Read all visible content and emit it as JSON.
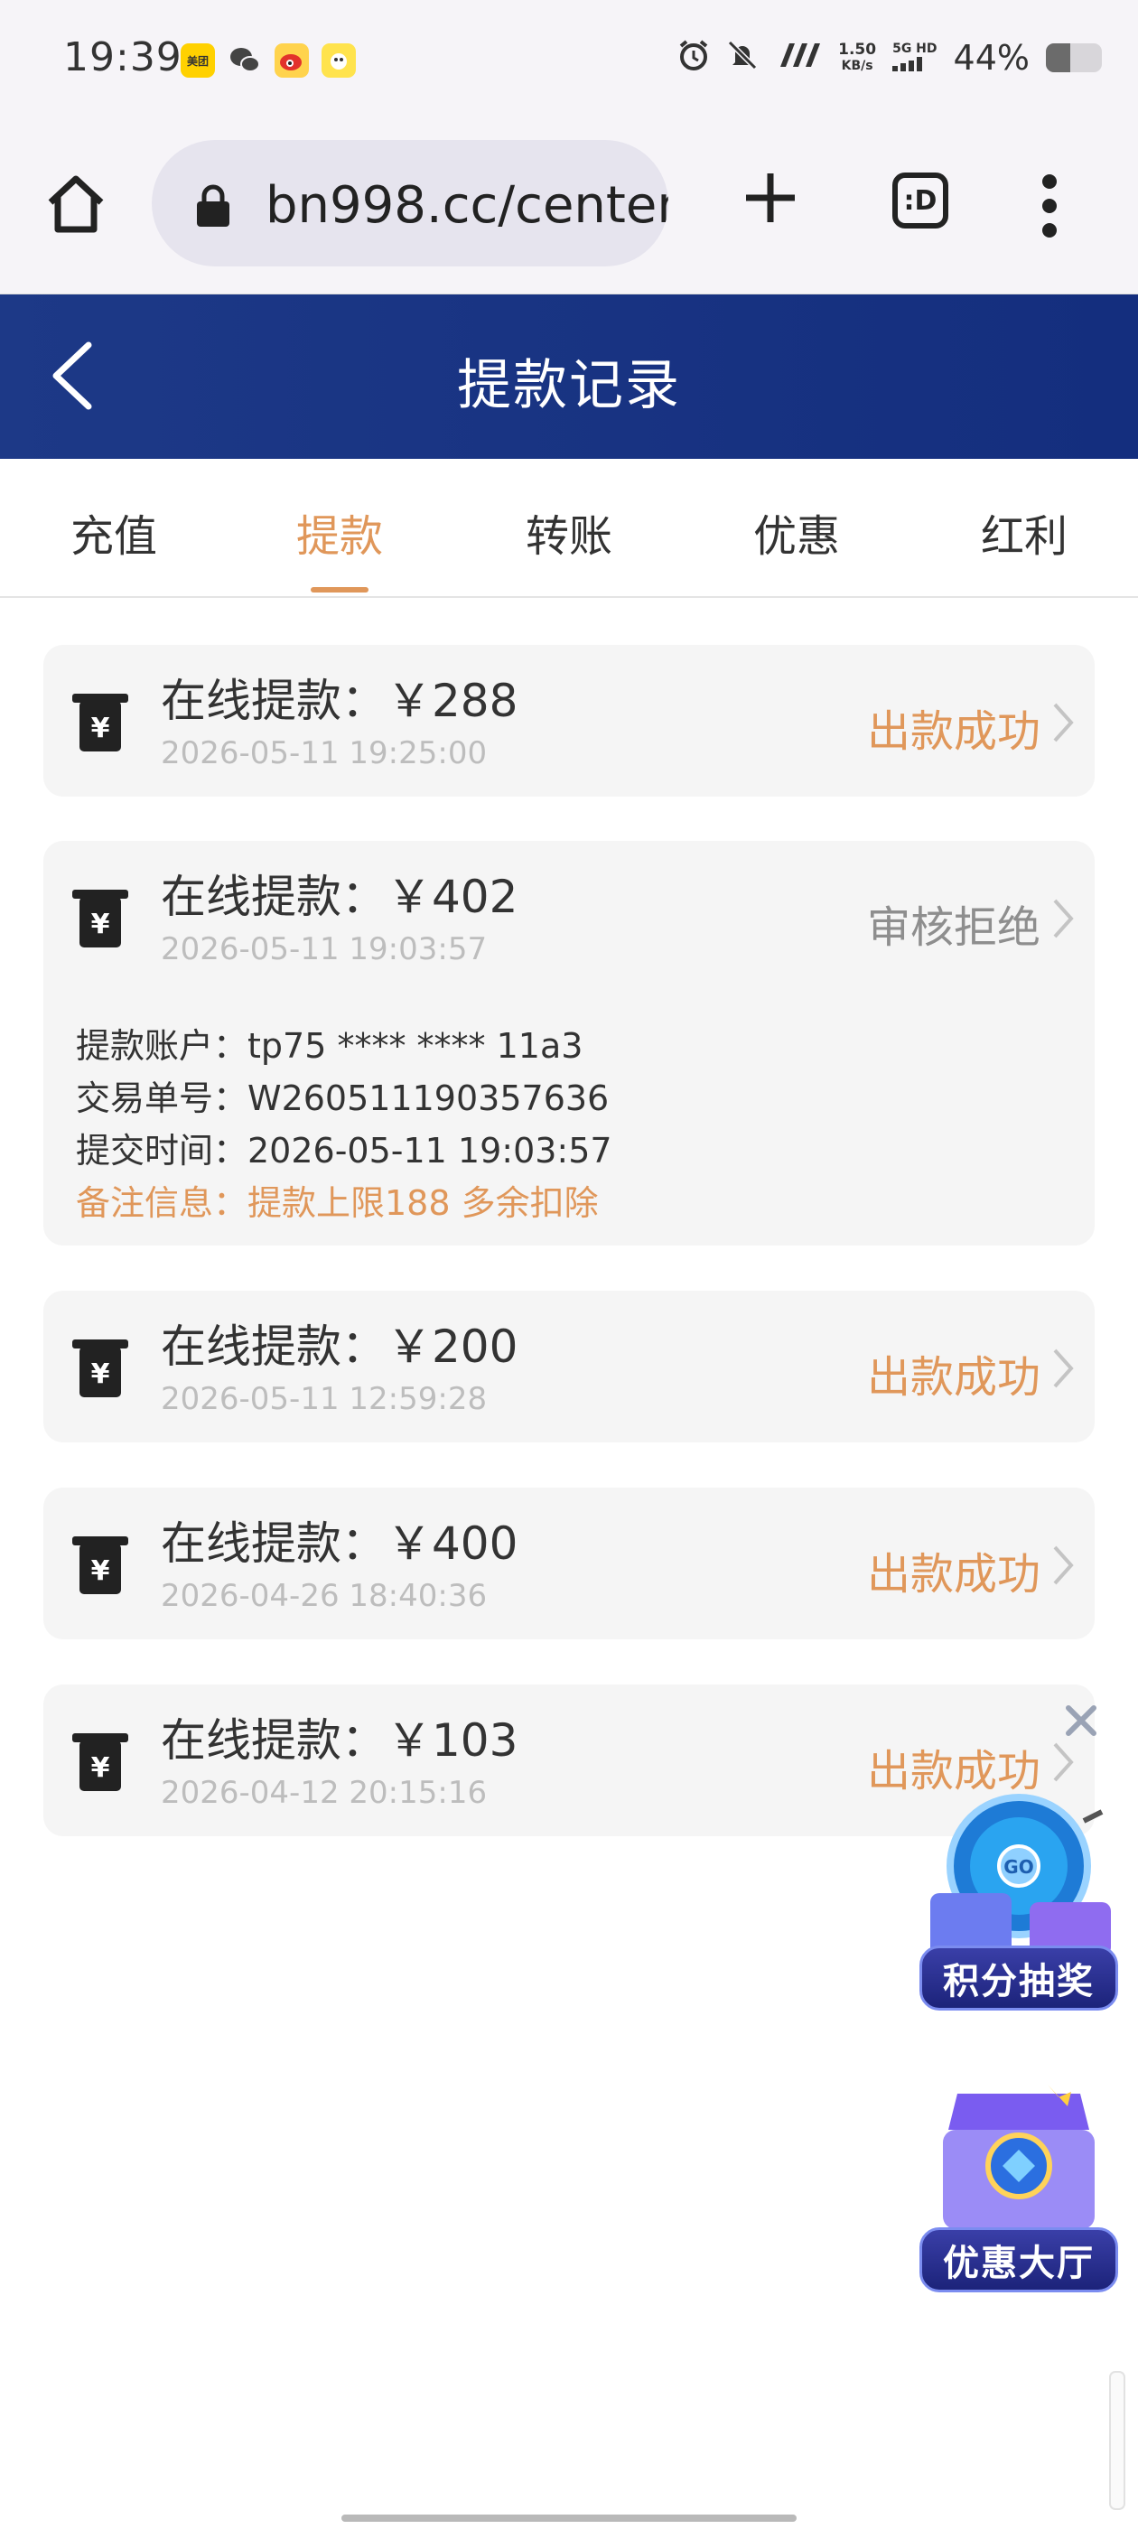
{
  "status_bar": {
    "time": "19:39",
    "apps": [
      {
        "icon": "meituan-app-icon",
        "label": "美团",
        "bg": "#ffd100"
      },
      {
        "icon": "wechat-app-icon",
        "label": "",
        "bg": "#f6f4f8"
      },
      {
        "icon": "weibo-app-icon",
        "label": "",
        "bg": "#ffd34d"
      },
      {
        "icon": "app-icon",
        "label": "",
        "bg": "#ffe34d"
      }
    ],
    "speed_value": "1.50",
    "speed_unit": "KB/s",
    "network": "5G HD",
    "battery_text": "44%",
    "battery_level": 0.44
  },
  "browser": {
    "url": "bn998.cc/center",
    "tabs_label": ":D"
  },
  "header": {
    "title": "提款记录"
  },
  "tabs": [
    "充值",
    "提款",
    "转账",
    "优惠",
    "红利"
  ],
  "active_tab": 1,
  "records": [
    {
      "title": "在线提款：￥288",
      "time": "2026-05-11 19:25:00",
      "status": "出款成功"
    },
    {
      "title": "在线提款：￥402",
      "time": "2026-05-11 19:03:57",
      "status": "审核拒绝",
      "details": {
        "account": "提款账户：tp75 **** **** 11a3",
        "order": "交易单号：W260511190357636",
        "submit": "提交时间：2026-05-11 19:03:57",
        "remark": "备注信息：提款上限188 多余扣除"
      }
    },
    {
      "title": "在线提款：￥200",
      "time": "2026-05-11 12:59:28",
      "status": "出款成功"
    },
    {
      "title": "在线提款：￥400",
      "time": "2026-04-26 18:40:36",
      "status": "出款成功"
    },
    {
      "title": "在线提款：￥103",
      "time": "2026-04-12 20:15:16",
      "status": "出款成功"
    }
  ],
  "float": {
    "lottery_label": "积分抽奖",
    "promo_label": "优惠大厅"
  },
  "colors": {
    "header_bg": "#1d3987",
    "accent": "#e0975a",
    "rejected": "#8e8e8e",
    "card_bg": "#f5f5f5"
  }
}
